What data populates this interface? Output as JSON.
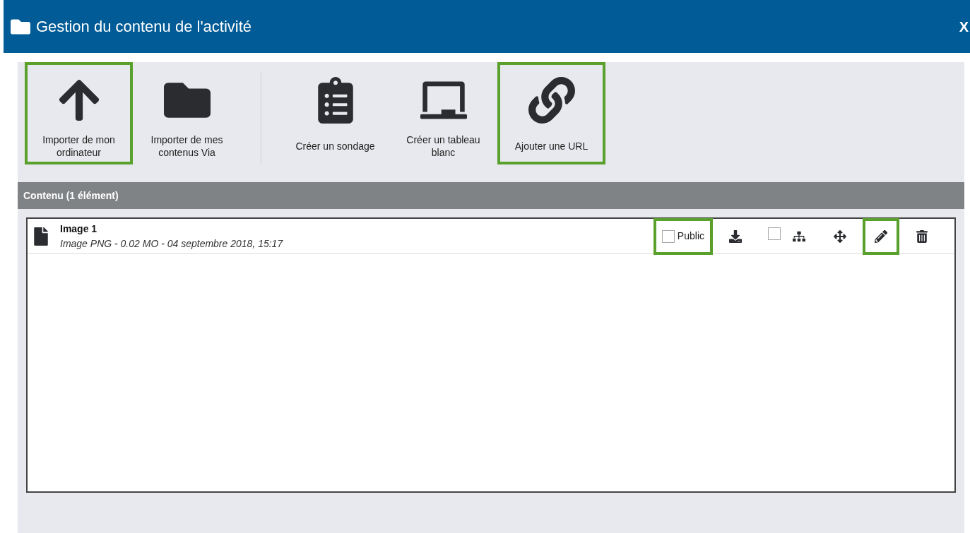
{
  "window": {
    "title": "Gestion du contenu de l'activité",
    "close": "X"
  },
  "toolbar": [
    {
      "kind": "upload",
      "label": "Importer de mon ordinateur",
      "highlighted": true,
      "separator_after": false
    },
    {
      "kind": "folder",
      "label": "Importer de mes contenus Via",
      "highlighted": false,
      "separator_after": true
    },
    {
      "kind": "survey",
      "label": "Créer un sondage",
      "highlighted": false,
      "separator_after": false
    },
    {
      "kind": "whiteboard",
      "label": "Créer un tableau blanc",
      "highlighted": false,
      "separator_after": false
    },
    {
      "kind": "link",
      "label": "Ajouter une URL",
      "highlighted": true,
      "separator_after": false
    }
  ],
  "content": {
    "header": "Contenu (1 élément)",
    "items": [
      {
        "name": "Image 1",
        "meta": "Image PNG - 0.02 MO - 04 septembre 2018, 15:17",
        "public": {
          "label": "Public",
          "checked": false,
          "highlighted": true
        },
        "actions": [
          {
            "kind": "download",
            "highlighted": false
          },
          {
            "kind": "structure",
            "checked": false,
            "highlighted": false
          },
          {
            "kind": "move",
            "highlighted": false
          },
          {
            "kind": "edit",
            "highlighted": true
          },
          {
            "kind": "delete",
            "highlighted": false
          }
        ]
      }
    ]
  }
}
